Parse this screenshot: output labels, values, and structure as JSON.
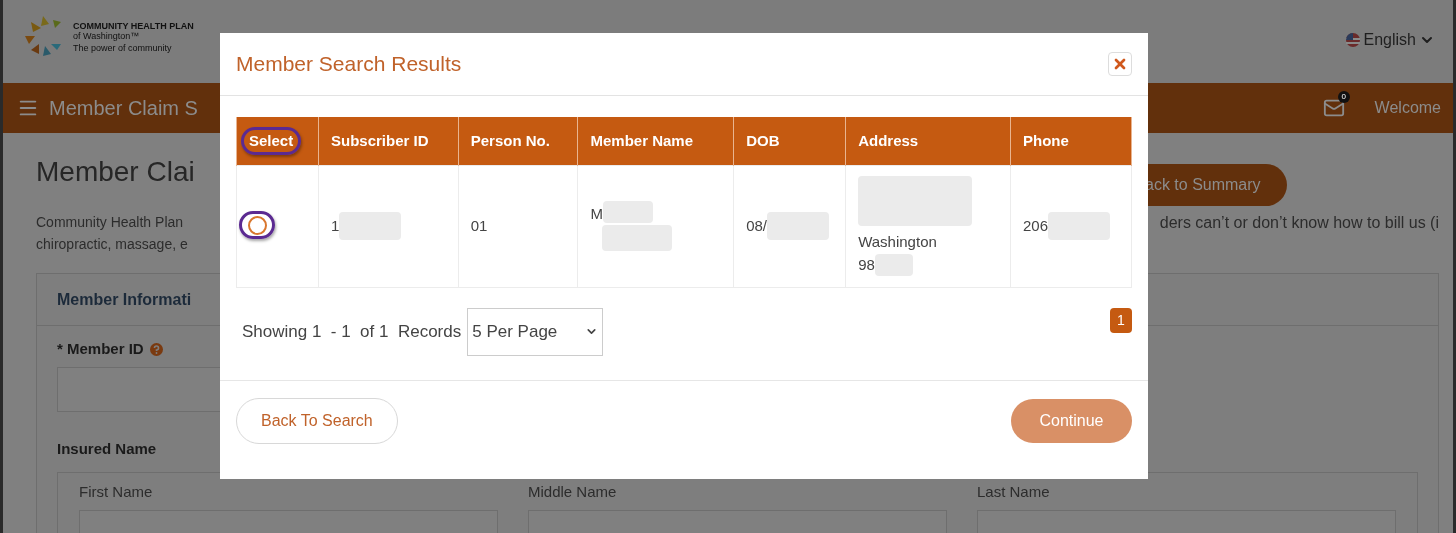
{
  "header": {
    "logo": {
      "name": "COMMUNITY HEALTH PLAN",
      "sub": "of Washington™",
      "tagline": "The power of community"
    },
    "language": "English"
  },
  "nav": {
    "title": "Member Claim S",
    "mail_count": "0",
    "welcome": "Welcome"
  },
  "page": {
    "title": "Member Clai",
    "back_button": "ack to Summary",
    "intro_left": [
      "Community Health Plan",
      "chiropractic, massage, e"
    ],
    "intro_right": "ders can’t or don’t know how to bill us (i",
    "section_title": "Member Informati",
    "member_id_label": "* Member ID",
    "insured_name_label": "Insured Name",
    "name_fields": [
      {
        "label": "First Name"
      },
      {
        "label": "Middle Name"
      },
      {
        "label": "Last Name"
      }
    ]
  },
  "modal": {
    "title": "Member Search Results",
    "table": {
      "columns": [
        {
          "label": "Select",
          "highlighted": true
        },
        {
          "label": "Subscriber ID",
          "highlighted": false
        },
        {
          "label": "Person No.",
          "highlighted": false
        },
        {
          "label": "Member Name",
          "highlighted": false
        },
        {
          "label": "DOB",
          "highlighted": false
        },
        {
          "label": "Address",
          "highlighted": false
        },
        {
          "label": "Phone",
          "highlighted": false
        }
      ],
      "rows": [
        {
          "selected": false,
          "highlighted": true,
          "cells": [
            {
              "kind": "radio"
            },
            {
              "kind": "redacted",
              "text": "1"
            },
            {
              "kind": "text",
              "text": "01"
            },
            {
              "kind": "name",
              "text": "M"
            },
            {
              "kind": "redacted",
              "text": "08/"
            },
            {
              "kind": "address",
              "lines": [
                "Washington",
                "98"
              ]
            },
            {
              "kind": "redacted",
              "text": "206"
            }
          ]
        }
      ]
    },
    "pagination": {
      "summary": "Showing 1  - 1  of 1  Records",
      "per_page": "5 Per Page",
      "pages": [
        {
          "label": "1",
          "selected": true
        }
      ]
    },
    "back_button": "Back To Search",
    "continue_button": "Continue"
  }
}
